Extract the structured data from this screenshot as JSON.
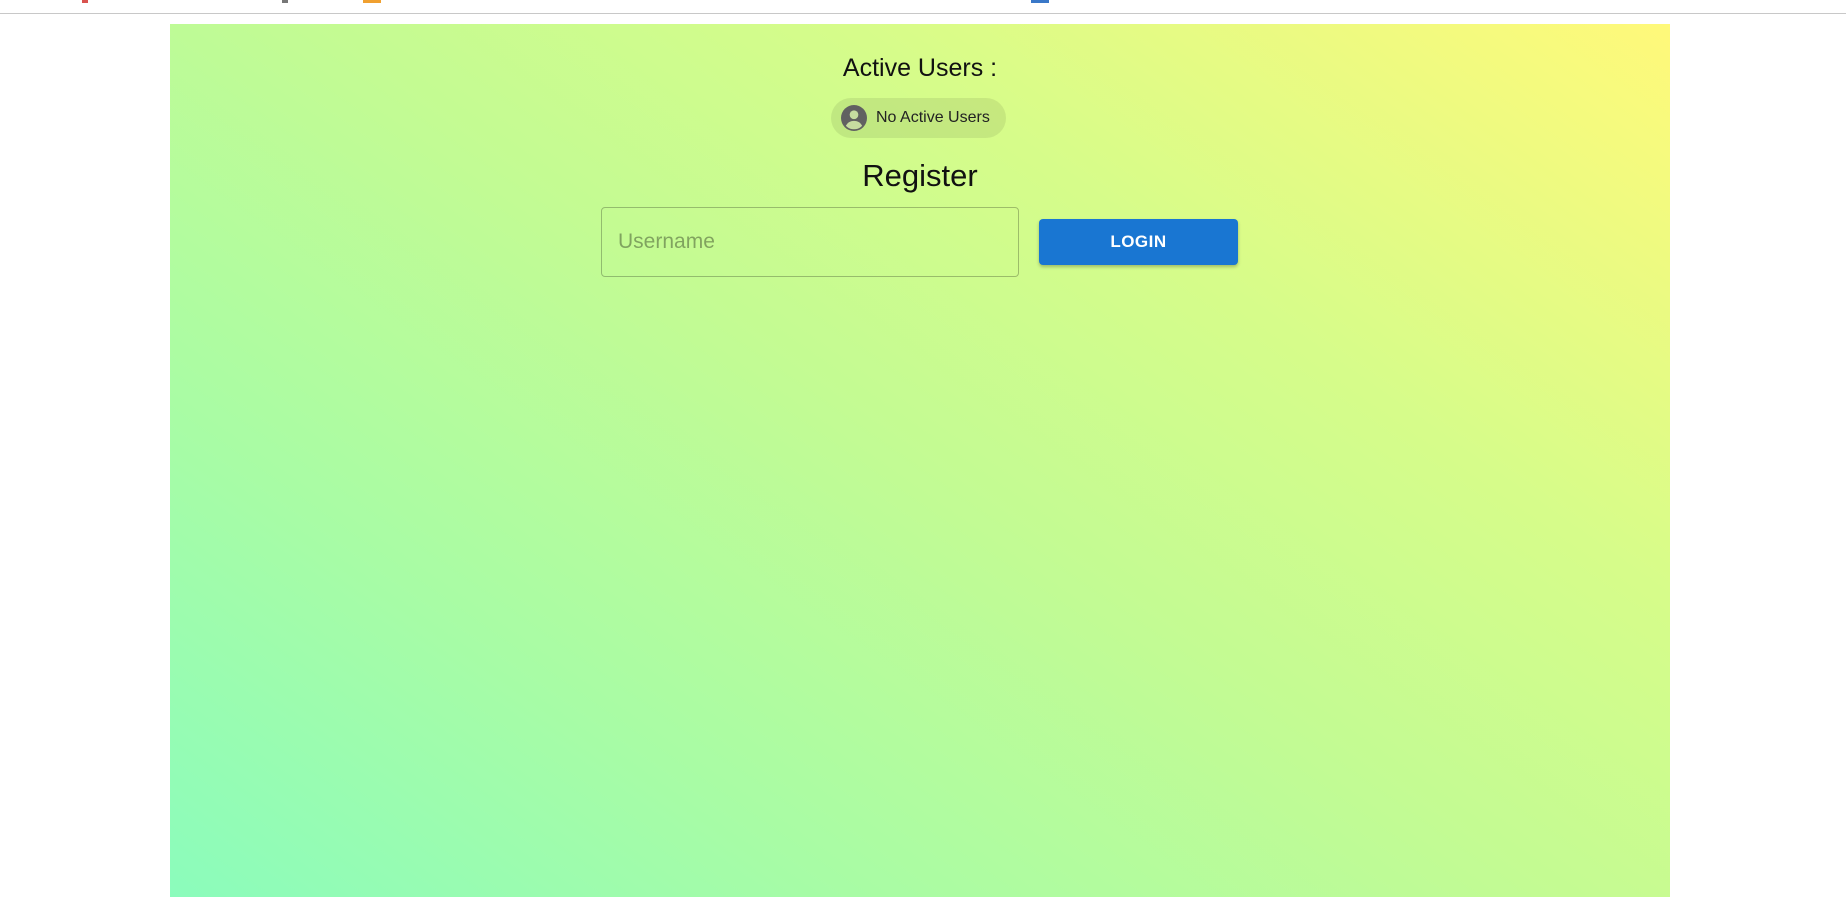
{
  "accent_color": "#1976d2",
  "active_users": {
    "title": "Active Users :",
    "chip_label": "No Active Users",
    "chip_icon": "account-circle-icon"
  },
  "register": {
    "title": "Register",
    "username_placeholder": "Username",
    "username_value": "",
    "login_label": "LOGIN"
  }
}
